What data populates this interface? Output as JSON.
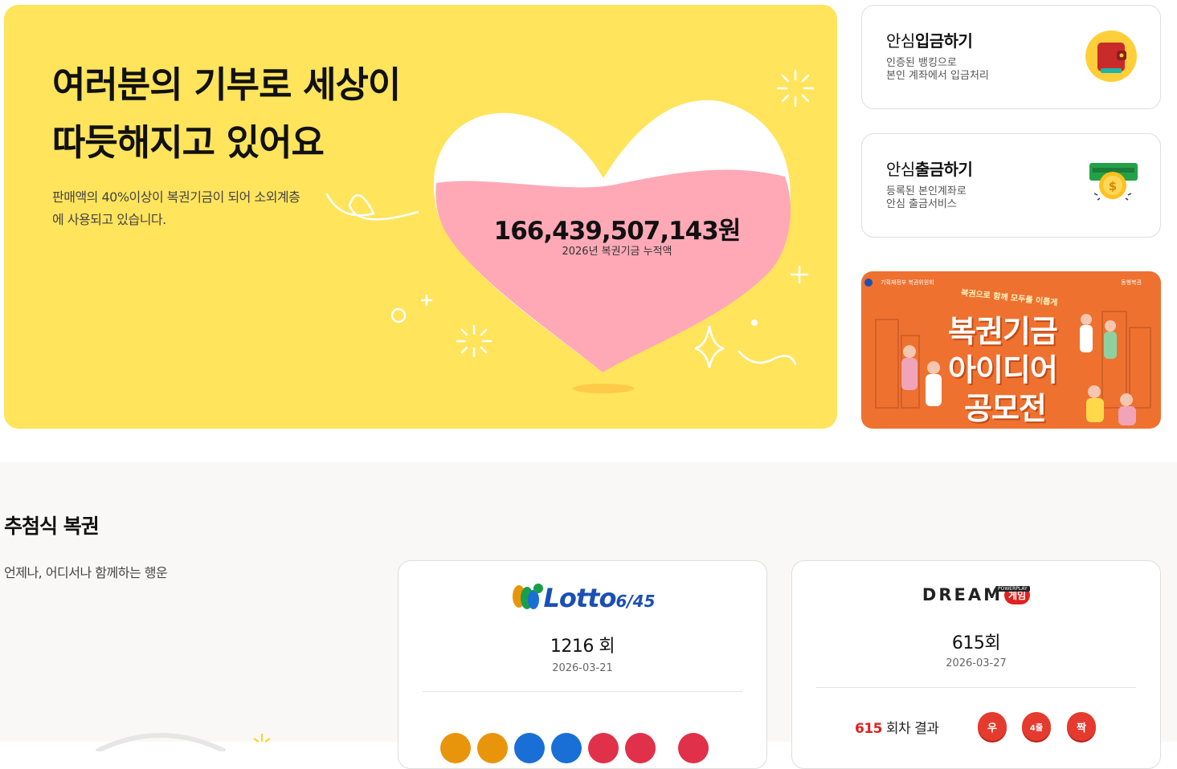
{
  "hero": {
    "title_line1": "여러분의 기부로 세상이",
    "title_line2": "따듯해지고 있어요",
    "desc": "판매액의 40%이상이 복권기금이 되어 소외계층에 사용되고 있습니다.",
    "fund_amount": "166,439,507,143원",
    "fund_label": "2026년 복권기금 누적액"
  },
  "deposit_card": {
    "title_prefix": "안심",
    "title_bold": "입금하기",
    "desc_line1": "인증된 뱅킹으로",
    "desc_line2": "본인 계좌에서 입금처리",
    "icon": "wallet-icon"
  },
  "withdraw_card": {
    "title_prefix": "안심",
    "title_bold": "출금하기",
    "desc_line1": "등록된 본인계좌로",
    "desc_line2": "안심 출금서비스",
    "icon": "coin-cash-icon"
  },
  "promo": {
    "org": "기획재정부 복권위원회",
    "brand": "동행복권",
    "subtitle": "복권으로 함께 모두를 이롭게",
    "line1": "복권기금",
    "line2": "아이디어",
    "line3": "공모전"
  },
  "section": {
    "title": "추첨식 복권",
    "subtitle": "언제나, 어디서나 함께하는 행운"
  },
  "lotto": {
    "logo_word": "Lotto",
    "logo_num": "6/45",
    "round": "1216 회",
    "date": "2026-03-21",
    "ball_colors": [
      "#e8950c",
      "#e8950c",
      "#1a6fd6",
      "#1a6fd6",
      "#e0304a",
      "#e0304a",
      "#e0304a"
    ]
  },
  "dream": {
    "logo_word": "DREAM",
    "logo_badge": "게임",
    "logo_tag": "POWERPLAY",
    "round": "615회",
    "date": "2026-03-27",
    "result_num": "615",
    "result_label": " 회차 결과",
    "badges": [
      "우",
      "4줄",
      "짝"
    ]
  },
  "colors": {
    "hero_bg": "#ffe45c",
    "heart_pink": "#ffa9b7",
    "promo_bg": "#ee7130",
    "accent_red": "#e0211d"
  }
}
